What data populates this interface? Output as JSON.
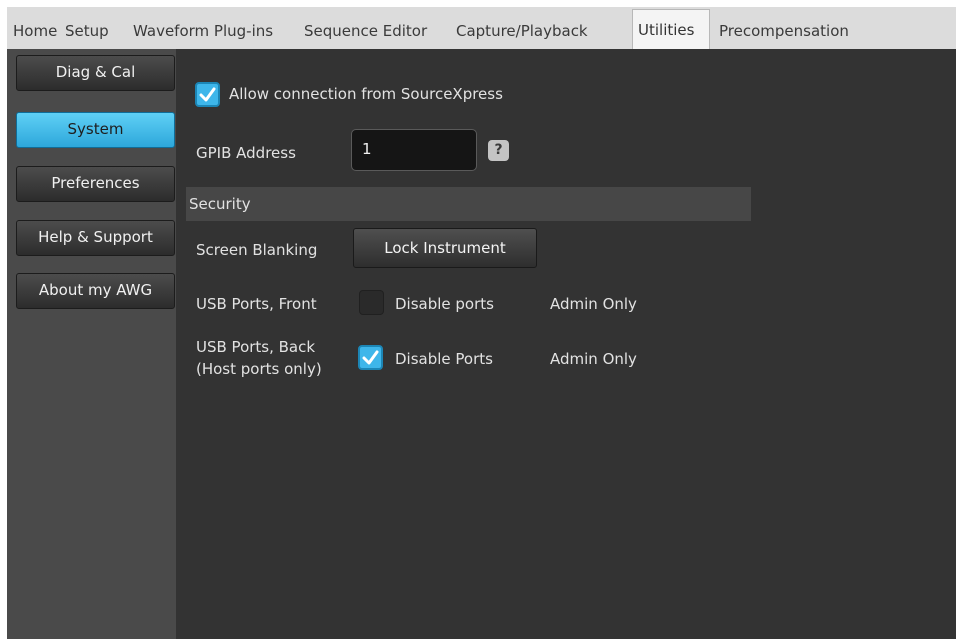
{
  "tabs": [
    {
      "label": "Home"
    },
    {
      "label": "Setup"
    },
    {
      "label": "Waveform Plug-ins"
    },
    {
      "label": "Sequence Editor"
    },
    {
      "label": "Capture/Playback"
    },
    {
      "label": "Utilities",
      "active": true
    },
    {
      "label": "Precompensation"
    }
  ],
  "sidebar": {
    "items": [
      {
        "label": "Diag & Cal"
      },
      {
        "label": "System",
        "active": true
      },
      {
        "label": "Preferences"
      },
      {
        "label": "Help & Support"
      },
      {
        "label": "About my AWG"
      }
    ]
  },
  "system": {
    "allow_connection": {
      "label": "Allow connection from SourceXpress",
      "checked": true
    },
    "gpib": {
      "label": "GPIB Address",
      "value": "1",
      "help": "?"
    },
    "security": {
      "title": "Security",
      "screen_blanking": {
        "label": "Screen Blanking",
        "button": "Lock Instrument"
      },
      "usb_front": {
        "label": "USB Ports, Front",
        "checkbox_label": "Disable ports",
        "checked": false,
        "note": "Admin Only"
      },
      "usb_back": {
        "label_line1": "USB Ports, Back",
        "label_line2": "(Host ports only)",
        "checkbox_label": "Disable Ports",
        "checked": true,
        "note": "Admin Only"
      }
    }
  },
  "colors": {
    "accent": "#3eb6ea",
    "panel": "#333333",
    "sidebar": "#4a4a4a"
  }
}
